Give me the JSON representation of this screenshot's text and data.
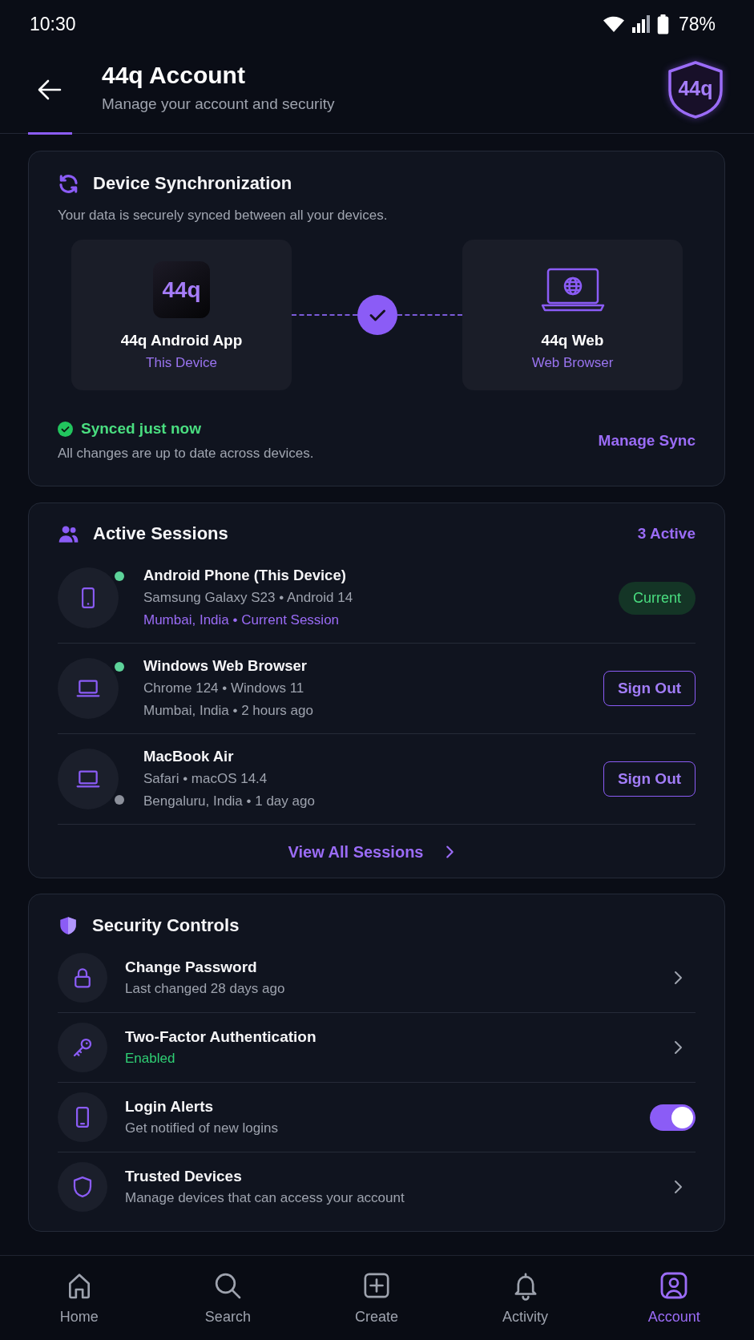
{
  "status_bar": {
    "time": "10:30",
    "battery": "78%"
  },
  "header": {
    "title": "44q Account",
    "subtitle": "Manage your account and security",
    "logo": "44q"
  },
  "sync": {
    "title": "Device Synchronization",
    "description": "Your data is securely synced between all your devices.",
    "devices": [
      {
        "kind": "app",
        "logo": "44q",
        "name": "44q Android App",
        "role": "This Device"
      },
      {
        "kind": "web",
        "name": "44q Web",
        "role": "Web Browser"
      }
    ],
    "status": "Synced just now",
    "detail": "All changes are up to date across devices.",
    "action": "Manage Sync"
  },
  "sessions": {
    "title": "Active Sessions",
    "count": "3 Active",
    "items": [
      {
        "kind": "phone",
        "name": "Android Phone (This Device)",
        "device": "Samsung Galaxy S23 • Android 14",
        "location": "Mumbai, India • Current Session",
        "online": true,
        "current": true,
        "action": "Current"
      },
      {
        "kind": "laptop",
        "name": "Windows Web Browser",
        "device": "Chrome 124 • Windows 11",
        "location": "Mumbai, India • 2 hours ago",
        "online": true,
        "current": false,
        "action": "Sign Out"
      },
      {
        "kind": "laptop",
        "name": "MacBook Air",
        "device": "Safari • macOS 14.4",
        "location": "Bengaluru, India • 1 day ago",
        "online": false,
        "current": false,
        "action": "Sign Out"
      }
    ],
    "view_all": "View All Sessions"
  },
  "security": {
    "title": "Security Controls",
    "items": [
      {
        "kind": "link",
        "title": "Change Password",
        "detail": "Last changed 28 days ago",
        "success": false
      },
      {
        "kind": "link",
        "title": "Two-Factor Authentication",
        "detail": "Enabled",
        "success": true
      },
      {
        "kind": "toggle",
        "title": "Login Alerts",
        "detail": "Get notified of new logins",
        "success": false,
        "on": true
      },
      {
        "kind": "link",
        "title": "Trusted Devices",
        "detail": "Manage devices that can access your account",
        "success": false
      }
    ]
  },
  "nav": {
    "items": [
      {
        "label": "Home",
        "selected": false
      },
      {
        "label": "Search",
        "selected": false
      },
      {
        "label": "Create",
        "selected": false
      },
      {
        "label": "Activity",
        "selected": false
      },
      {
        "label": "Account",
        "selected": true
      }
    ]
  }
}
